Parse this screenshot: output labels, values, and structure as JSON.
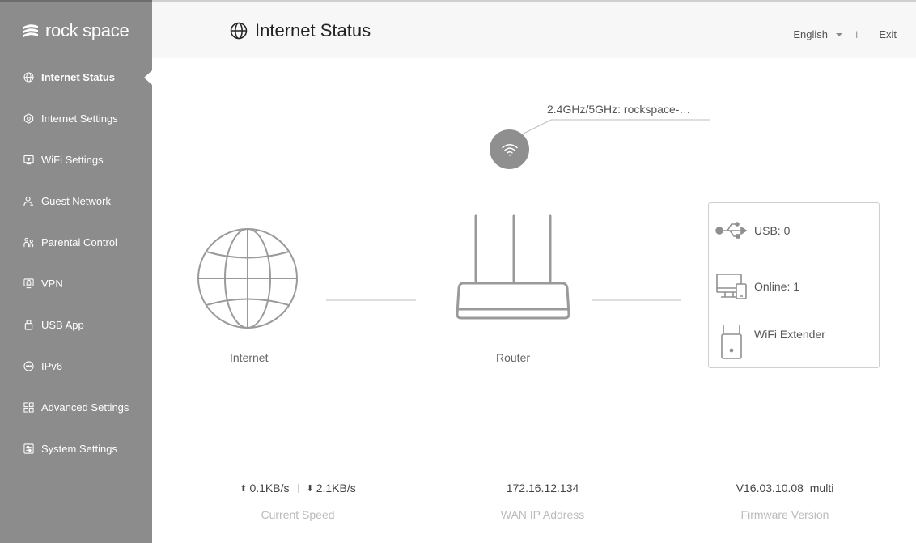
{
  "brand": {
    "name": "rock space"
  },
  "sidebar": {
    "items": [
      {
        "label": "Internet Status",
        "icon": "globe-icon",
        "active": true
      },
      {
        "label": "Internet Settings",
        "icon": "internet-settings-icon"
      },
      {
        "label": "WiFi Settings",
        "icon": "wifi-settings-icon"
      },
      {
        "label": "Guest Network",
        "icon": "guest-network-icon"
      },
      {
        "label": "Parental Control",
        "icon": "parental-control-icon"
      },
      {
        "label": "VPN",
        "icon": "vpn-icon"
      },
      {
        "label": "USB App",
        "icon": "usb-app-icon"
      },
      {
        "label": "IPv6",
        "icon": "ipv6-icon"
      },
      {
        "label": "Advanced Settings",
        "icon": "advanced-settings-icon"
      },
      {
        "label": "System Settings",
        "icon": "system-settings-icon"
      }
    ]
  },
  "header": {
    "title": "Internet Status",
    "language": "English",
    "separator": "I",
    "exit_label": "Exit"
  },
  "diagram": {
    "wifi_ssid": "2.4GHz/5GHz: rockspace-…",
    "internet_label": "Internet",
    "router_label": "Router",
    "devices": {
      "usb": "USB: 0",
      "online": "Online: 1",
      "extender": "WiFi Extender"
    }
  },
  "stats": {
    "upload": "0.1KB/s",
    "download": "2.1KB/s",
    "current_speed_label": "Current Speed",
    "wan_ip": "172.16.12.134",
    "wan_ip_label": "WAN IP Address",
    "firmware": "V16.03.10.08_multi",
    "firmware_label": "Firmware Version"
  },
  "colors": {
    "sidebar_bg": "#8c8c8c",
    "header_bg": "#f7f7f7",
    "icon_gray": "#8f8f8f"
  }
}
